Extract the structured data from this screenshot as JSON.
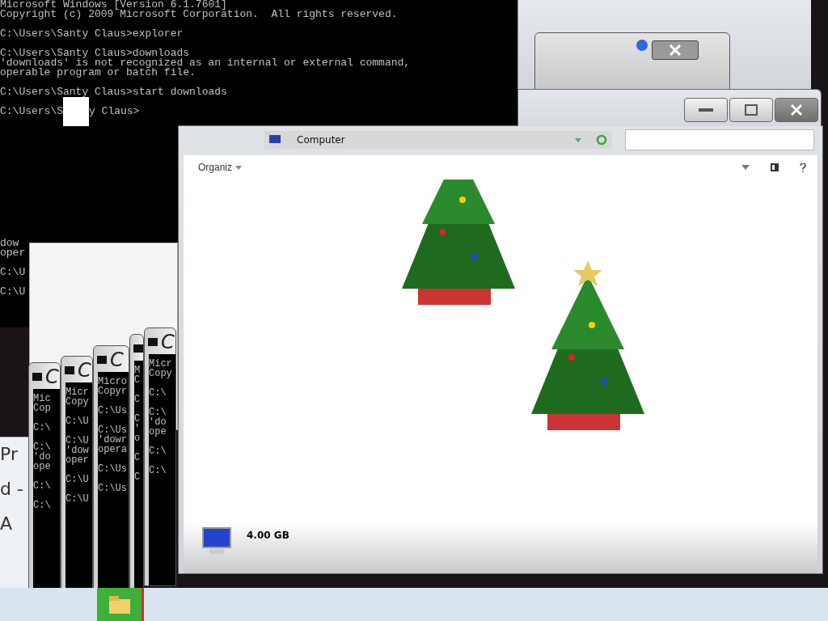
{
  "console": {
    "lines": [
      {
        "kind": "text",
        "text": "Microsoft Windows [Version 6.1.7601]"
      },
      {
        "kind": "text",
        "text": "Copyright (c) 2009 Microsoft Corporation.  All rights reserved."
      },
      {
        "kind": "blank"
      },
      {
        "kind": "text",
        "text": "C:\\Users\\Santy Claus>explorer"
      },
      {
        "kind": "blank"
      },
      {
        "kind": "text",
        "text": "C:\\Users\\Santy Claus>downloads"
      },
      {
        "kind": "text",
        "text": "'downloads' is not recognized as an internal or external command,"
      },
      {
        "kind": "text",
        "text": "operable program or batch file."
      },
      {
        "kind": "blank"
      },
      {
        "kind": "text",
        "text": "C:\\Users\\Santy Claus>start downloads"
      },
      {
        "kind": "blank"
      },
      {
        "kind": "masked",
        "before": "C:\\Users\\S",
        "after": "y Claus>"
      }
    ]
  },
  "console_fragment": {
    "lines": [
      {
        "kind": "text",
        "text": "dow"
      },
      {
        "kind": "text",
        "text": "oper"
      },
      {
        "kind": "blank"
      },
      {
        "kind": "text",
        "text": "C:\\U"
      },
      {
        "kind": "blank"
      },
      {
        "kind": "text",
        "text": "C:\\U"
      }
    ]
  },
  "background_fragments": [
    "Pr",
    "d -",
    "A"
  ],
  "ghost_consoles": [
    {
      "title": "C",
      "lines": [
        {
          "kind": "text",
          "text": "Mic"
        },
        {
          "kind": "text",
          "text": "Cop"
        },
        {
          "kind": "blank"
        },
        {
          "kind": "text",
          "text": "C:\\"
        },
        {
          "kind": "blank"
        },
        {
          "kind": "text",
          "text": "C:\\"
        },
        {
          "kind": "text",
          "text": "'do"
        },
        {
          "kind": "text",
          "text": "ope"
        },
        {
          "kind": "blank"
        },
        {
          "kind": "text",
          "text": "C:\\"
        },
        {
          "kind": "blank"
        },
        {
          "kind": "text",
          "text": "C:\\"
        }
      ]
    },
    {
      "title": "C",
      "lines": [
        {
          "kind": "text",
          "text": "Micr"
        },
        {
          "kind": "text",
          "text": "Copy"
        },
        {
          "kind": "blank"
        },
        {
          "kind": "text",
          "text": "C:\\U"
        },
        {
          "kind": "blank"
        },
        {
          "kind": "text",
          "text": "C:\\U"
        },
        {
          "kind": "text",
          "text": "'dow"
        },
        {
          "kind": "text",
          "text": "oper"
        },
        {
          "kind": "blank"
        },
        {
          "kind": "text",
          "text": "C:\\U"
        },
        {
          "kind": "blank"
        },
        {
          "kind": "text",
          "text": "C:\\U"
        }
      ]
    },
    {
      "title": "C",
      "lines": [
        {
          "kind": "text",
          "text": "Micro"
        },
        {
          "kind": "text",
          "text": "Copyr"
        },
        {
          "kind": "blank"
        },
        {
          "kind": "text",
          "text": "C:\\Us"
        },
        {
          "kind": "blank"
        },
        {
          "kind": "text",
          "text": "C:\\Us"
        },
        {
          "kind": "text",
          "text": "'dowr"
        },
        {
          "kind": "text",
          "text": "opera"
        },
        {
          "kind": "blank"
        },
        {
          "kind": "text",
          "text": "C:\\Us"
        },
        {
          "kind": "blank"
        },
        {
          "kind": "text",
          "text": "C:\\Us"
        }
      ]
    },
    {
      "lines": [
        {
          "kind": "text",
          "text": "M"
        },
        {
          "kind": "text",
          "text": "C"
        },
        {
          "kind": "blank"
        },
        {
          "kind": "text",
          "text": "C"
        },
        {
          "kind": "blank"
        },
        {
          "kind": "text",
          "text": "C"
        },
        {
          "kind": "text",
          "text": "'"
        },
        {
          "kind": "text",
          "text": "o"
        },
        {
          "kind": "blank"
        },
        {
          "kind": "text",
          "text": "C"
        },
        {
          "kind": "blank"
        },
        {
          "kind": "text",
          "text": "C"
        }
      ]
    },
    {
      "title": "C",
      "lines": [
        {
          "kind": "text",
          "text": "Micr"
        },
        {
          "kind": "text",
          "text": "Copy"
        },
        {
          "kind": "blank"
        },
        {
          "kind": "text",
          "text": "C:\\"
        },
        {
          "kind": "blank"
        },
        {
          "kind": "text",
          "text": "C:\\"
        },
        {
          "kind": "text",
          "text": "'do"
        },
        {
          "kind": "text",
          "text": "ope"
        },
        {
          "kind": "blank"
        },
        {
          "kind": "text",
          "text": "C:\\"
        },
        {
          "kind": "blank"
        },
        {
          "kind": "text",
          "text": "C:\\"
        }
      ]
    }
  ],
  "explorer": {
    "address": "Computer",
    "organize": "Organiz",
    "details": {
      "memory": "4.00 GB"
    }
  }
}
